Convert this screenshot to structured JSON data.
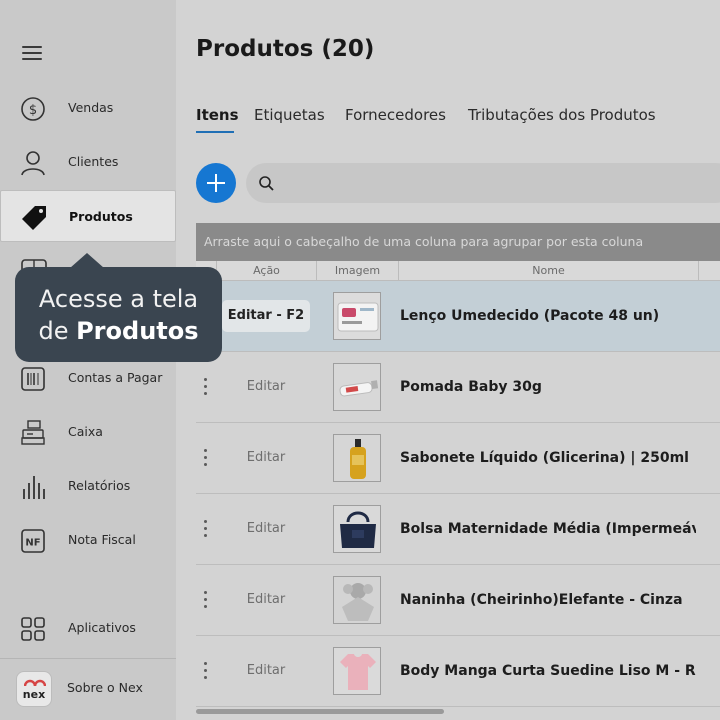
{
  "sidebar": {
    "items": [
      {
        "label": "Vendas",
        "icon": "dollar-icon"
      },
      {
        "label": "Clientes",
        "icon": "person-icon"
      },
      {
        "label": "Produtos",
        "icon": "tag-icon",
        "active": true
      },
      {
        "label": "Contas a Pagar",
        "icon": "barcode-icon"
      },
      {
        "label": "Caixa",
        "icon": "cash-register-icon"
      },
      {
        "label": "Relatórios",
        "icon": "bars-icon"
      },
      {
        "label": "Nota Fiscal",
        "icon": "nf-icon"
      },
      {
        "label": "Aplicativos",
        "icon": "apps-grid-icon"
      },
      {
        "label": "Sobre o Nex",
        "icon": "nex-logo"
      }
    ],
    "nf_glyph": "NF",
    "nex_logo_text": "nex"
  },
  "tooltip": {
    "line1": "Acesse a tela",
    "line2_prefix": "de ",
    "line2_bold": "Produtos"
  },
  "page": {
    "title": "Produtos (20)"
  },
  "tabs": [
    "Itens",
    "Etiquetas",
    "Fornecedores",
    "Tributações dos Produtos"
  ],
  "grid": {
    "group_hint": "Arraste aqui o cabeçalho de uma coluna para agrupar por esta coluna",
    "columns": [
      "Ação",
      "Imagem",
      "Nome"
    ],
    "rows": [
      {
        "action": "Editar - F2",
        "name": "Lenço Umedecido (Pacote 48 un)",
        "selected": true
      },
      {
        "action": "Editar",
        "name": "Pomada Baby 30g"
      },
      {
        "action": "Editar",
        "name": "Sabonete Líquido (Glicerina) | 250ml"
      },
      {
        "action": "Editar",
        "name": "Bolsa Maternidade Média (Impermeável) - A"
      },
      {
        "action": "Editar",
        "name": "Naninha (Cheirinho)Elefante - Cinza"
      },
      {
        "action": "Editar",
        "name": "Body Manga Curta Suedine Liso M - Rosa Be"
      }
    ]
  },
  "colors": {
    "accent": "#1677d2",
    "tooltip_bg": "#3a4550",
    "selected_row": "#c3cfd6"
  }
}
